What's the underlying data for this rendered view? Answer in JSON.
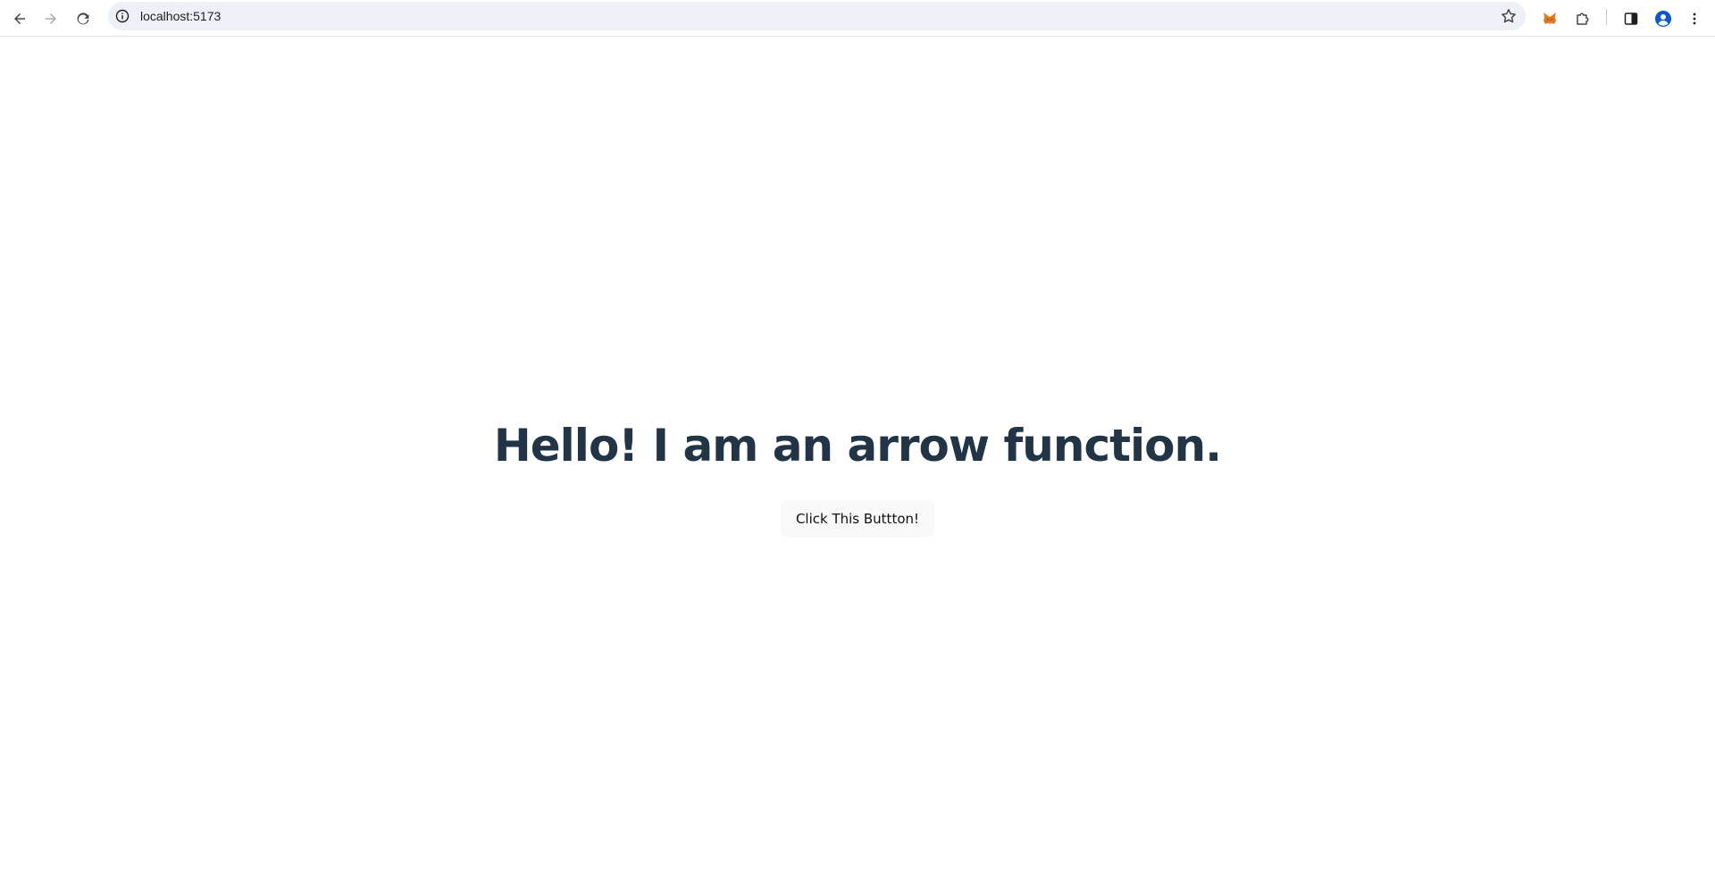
{
  "browser": {
    "url": "localhost:5173",
    "icons": {
      "back": "back-arrow-icon",
      "forward": "forward-arrow-icon",
      "reload": "reload-icon",
      "site_info": "site-info-icon",
      "bookmark": "star-icon",
      "extension_metamask": "metamask-fox-icon",
      "extensions": "puzzle-icon",
      "side_panel": "side-panel-icon",
      "profile": "profile-avatar-icon",
      "menu": "kebab-menu-icon"
    }
  },
  "page": {
    "heading": "Hello! I am an arrow function.",
    "button_label": "Click This Buttton!"
  },
  "colors": {
    "heading": "#213547",
    "button_bg": "#f9f9f9",
    "omnibox_bg": "#edf0f7",
    "profile_accent": "#0b57d0"
  }
}
